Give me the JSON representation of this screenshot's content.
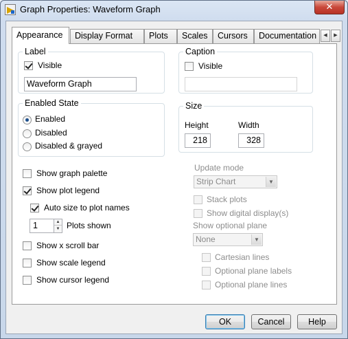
{
  "window": {
    "title": "Graph Properties: Waveform Graph",
    "close_label": "✕"
  },
  "tabs": [
    {
      "label": "Appearance",
      "active": true
    },
    {
      "label": "Display Format"
    },
    {
      "label": "Plots"
    },
    {
      "label": "Scales"
    },
    {
      "label": "Cursors"
    },
    {
      "label": "Documentation"
    }
  ],
  "tab_scroll": {
    "left": "◀",
    "right": "▶"
  },
  "label_group": {
    "title": "Label",
    "visible_label": "Visible",
    "visible_checked": true,
    "value": "Waveform Graph"
  },
  "caption_group": {
    "title": "Caption",
    "visible_label": "Visible",
    "visible_checked": false,
    "value": ""
  },
  "enabled_state": {
    "title": "Enabled State",
    "options": [
      "Enabled",
      "Disabled",
      "Disabled & grayed"
    ],
    "selected": "Enabled"
  },
  "size_group": {
    "title": "Size",
    "height_label": "Height",
    "height_value": "218",
    "width_label": "Width",
    "width_value": "328"
  },
  "options": {
    "show_graph_palette": {
      "label": "Show graph palette",
      "checked": false
    },
    "show_plot_legend": {
      "label": "Show plot legend",
      "checked": true
    },
    "auto_size": {
      "label": "Auto size to plot names",
      "checked": true
    },
    "plots_shown_value": "1",
    "plots_shown_label": "Plots shown",
    "show_x_scroll": {
      "label": "Show x scroll bar",
      "checked": false
    },
    "show_scale_legend": {
      "label": "Show scale legend",
      "checked": false
    },
    "show_cursor_legend": {
      "label": "Show cursor legend",
      "checked": false
    }
  },
  "update_mode": {
    "label": "Update mode",
    "value": "Strip Chart",
    "stack_plots": "Stack plots",
    "show_digital_display": "Show digital display(s)",
    "optional_plane_label": "Show optional plane",
    "optional_plane_value": "None",
    "cartesian_lines": "Cartesian lines",
    "plane_labels": "Optional plane labels",
    "plane_lines": "Optional plane lines"
  },
  "buttons": {
    "ok": "OK",
    "cancel": "Cancel",
    "help": "Help"
  },
  "icons": {
    "dropdown_arrow": "▼",
    "spin_up": "▲",
    "spin_down": "▼"
  }
}
